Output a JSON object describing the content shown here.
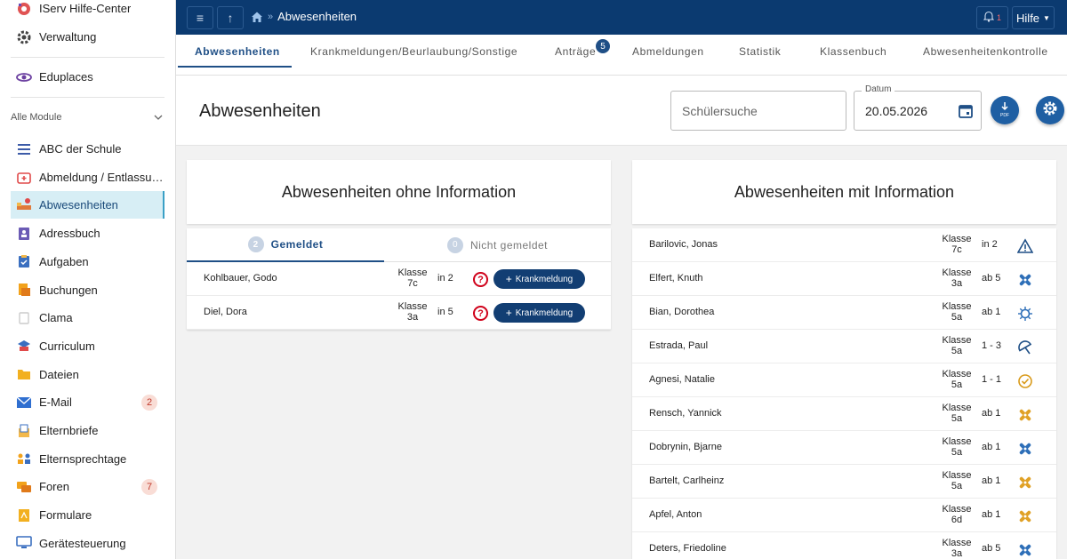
{
  "sidebar": {
    "top_items": [
      {
        "label": "IServ Hilfe-Center",
        "icon": "lifebuoy-icon"
      },
      {
        "label": "Verwaltung",
        "icon": "gear-icon"
      },
      {
        "label": "Eduplaces",
        "icon": "eduplaces-icon"
      }
    ],
    "section_label": "Alle Module",
    "modules": [
      {
        "label": "ABC der Schule",
        "icon": "list-icon",
        "badge": ""
      },
      {
        "label": "Abmeldung / Entlassu…",
        "icon": "first-aid-icon",
        "badge": ""
      },
      {
        "label": "Abwesenheiten",
        "icon": "bed-icon",
        "badge": "",
        "active": true
      },
      {
        "label": "Adressbuch",
        "icon": "address-book-icon",
        "badge": ""
      },
      {
        "label": "Aufgaben",
        "icon": "clipboard-icon",
        "badge": ""
      },
      {
        "label": "Buchungen",
        "icon": "booking-icon",
        "badge": ""
      },
      {
        "label": "Clama",
        "icon": "clama-icon",
        "badge": ""
      },
      {
        "label": "Curriculum",
        "icon": "curriculum-icon",
        "badge": ""
      },
      {
        "label": "Dateien",
        "icon": "folder-icon",
        "badge": ""
      },
      {
        "label": "E-Mail",
        "icon": "mail-icon",
        "badge": "2"
      },
      {
        "label": "Elternbriefe",
        "icon": "letter-icon",
        "badge": ""
      },
      {
        "label": "Elternsprechtage",
        "icon": "people-icon",
        "badge": ""
      },
      {
        "label": "Foren",
        "icon": "forum-icon",
        "badge": "7"
      },
      {
        "label": "Formulare",
        "icon": "form-icon",
        "badge": ""
      },
      {
        "label": "Gerätesteuerung",
        "icon": "monitor-icon",
        "badge": ""
      }
    ]
  },
  "topbar": {
    "breadcrumb": "Abwesenheiten",
    "notification_count": "1",
    "help_label": "Hilfe"
  },
  "tabs": [
    {
      "label": "Abwesenheiten",
      "active": true
    },
    {
      "label": "Krankmeldungen/Beurlaubung/Sonstige"
    },
    {
      "label": "Anträge",
      "badge": "5"
    },
    {
      "label": "Abmeldungen"
    },
    {
      "label": "Statistik"
    },
    {
      "label": "Klassenbuch"
    },
    {
      "label": "Abwesenheitenkontrolle"
    }
  ],
  "header": {
    "title": "Abwesenheiten",
    "search_placeholder": "Schülersuche",
    "date_label": "Datum",
    "date_value": "20.05.2026",
    "pdf_label": "PDF"
  },
  "left_panel": {
    "title": "Abwesenheiten ohne Information",
    "subtabs": [
      {
        "count": "2",
        "label": "Gemeldet",
        "active": true
      },
      {
        "count": "0",
        "label": "Nicht gemeldet"
      }
    ],
    "rows": [
      {
        "name": "Kohlbauer, Godo",
        "klasse_label": "Klasse",
        "klasse": "7c",
        "period": "in 2",
        "button": "Krankmeldung"
      },
      {
        "name": "Diel, Dora",
        "klasse_label": "Klasse",
        "klasse": "3a",
        "period": "in 5",
        "button": "Krankmeldung"
      }
    ]
  },
  "right_panel": {
    "title": "Abwesenheiten mit Information",
    "rows": [
      {
        "name": "Barilovic, Jonas",
        "klasse": "7c",
        "period": "in 2",
        "icon": "warning-icon",
        "color": "#1f4f86"
      },
      {
        "name": "Elfert, Knuth",
        "klasse": "3a",
        "period": "ab 5",
        "icon": "bandage-icon",
        "color": "#2e6fb8"
      },
      {
        "name": "Bian, Dorothea",
        "klasse": "5a",
        "period": "ab 1",
        "icon": "virus-icon",
        "color": "#2e6fb8"
      },
      {
        "name": "Estrada, Paul",
        "klasse": "5a",
        "period": "1 - 3",
        "icon": "umbrella-icon",
        "color": "#1f4f86"
      },
      {
        "name": "Agnesi, Natalie",
        "klasse": "5a",
        "period": "1 - 1",
        "icon": "check-circle-icon",
        "color": "#d99a1a"
      },
      {
        "name": "Rensch, Yannick",
        "klasse": "5a",
        "period": "ab 1",
        "icon": "bandage-icon",
        "color": "#e0a126"
      },
      {
        "name": "Dobrynin, Bjarne",
        "klasse": "5a",
        "period": "ab 1",
        "icon": "bandage-icon",
        "color": "#2e6fb8"
      },
      {
        "name": "Bartelt, Carlheinz",
        "klasse": "5a",
        "period": "ab 1",
        "icon": "bandage-icon",
        "color": "#e0a126"
      },
      {
        "name": "Apfel, Anton",
        "klasse": "6d",
        "period": "ab 1",
        "icon": "bandage-icon",
        "color": "#e0a126"
      },
      {
        "name": "Deters, Friedoline",
        "klasse": "3a",
        "period": "ab 5",
        "icon": "bandage-icon",
        "color": "#2e6fb8"
      }
    ],
    "klasse_label": "Klasse"
  }
}
